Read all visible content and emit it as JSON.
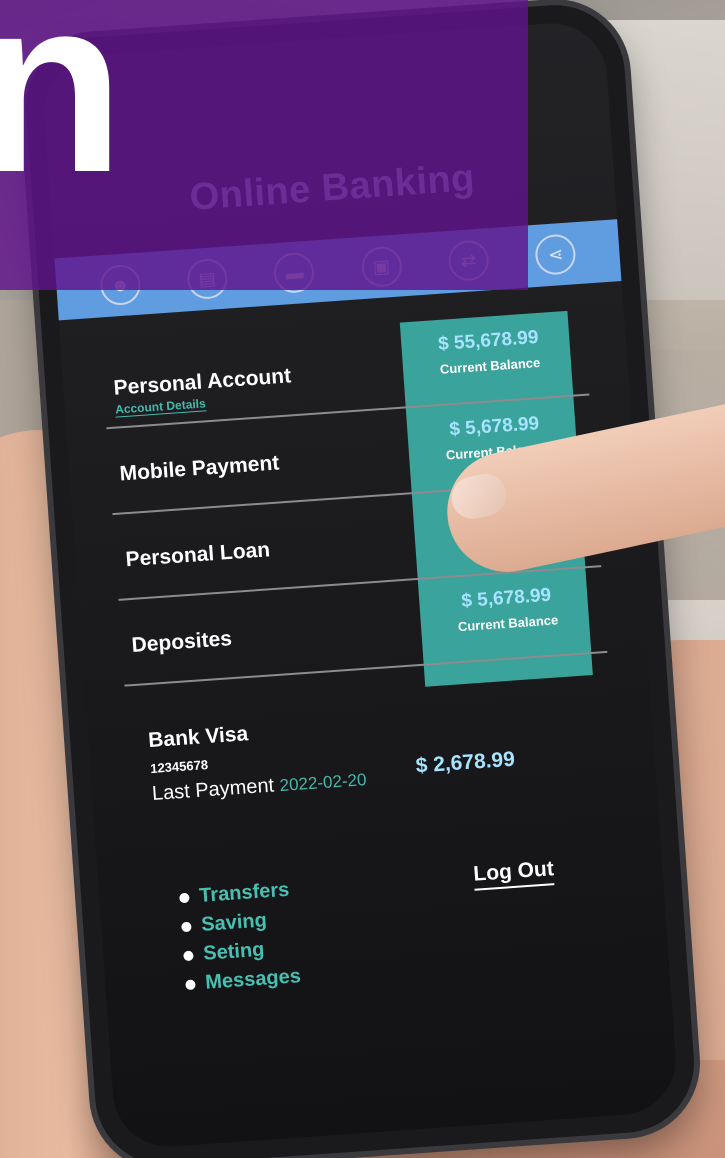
{
  "overlay": {
    "text": "n",
    "color": "#60148C"
  },
  "app": {
    "title": "Online Banking",
    "nav_icons": [
      "user-icon",
      "bank-icon",
      "card-icon",
      "lock-icon",
      "transfer-icon",
      "share-icon"
    ]
  },
  "accounts": [
    {
      "name": "Personal Account",
      "sub": "Account Details",
      "amount": "$ 55,678.99",
      "label": "Current Balance"
    },
    {
      "name": "Mobile Payment",
      "sub": "",
      "amount": "$ 5,678.99",
      "label": "Current Balance"
    },
    {
      "name": "Personal Loan",
      "sub": "",
      "amount": "$ ",
      "label": "Curren"
    },
    {
      "name": "Deposites",
      "sub": "",
      "amount": "$ 5,678.99",
      "label": "Current Balance"
    }
  ],
  "visa": {
    "title": "Bank Visa",
    "number": "12345678",
    "last_payment_label": "Last Payment",
    "last_payment_date": "2022-02-20",
    "amount": "$ 2,678.99"
  },
  "menu": [
    "Transfers",
    "Saving",
    "Seting",
    "Messages"
  ],
  "logout_label": "Log Out",
  "colors": {
    "accent_teal": "#3AA39B",
    "nav_blue": "#5F9CE0",
    "amount_blue": "#A7E3FF"
  }
}
